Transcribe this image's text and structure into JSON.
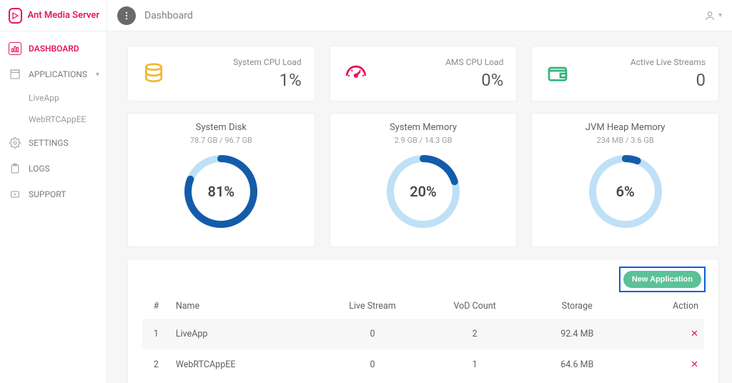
{
  "brand": "Ant Media Server",
  "page_title": "Dashboard",
  "sidebar": {
    "dashboard": "DASHBOARD",
    "applications": "APPLICATIONS",
    "app1": "LiveApp",
    "app2": "WebRTCAppEE",
    "settings": "SETTINGS",
    "logs": "LOGS",
    "support": "SUPPORT"
  },
  "stats": {
    "sys_cpu_label": "System CPU Load",
    "sys_cpu_value": "1%",
    "ams_cpu_label": "AMS CPU Load",
    "ams_cpu_value": "0%",
    "streams_label": "Active Live Streams",
    "streams_value": "0"
  },
  "gauges": {
    "disk_title": "System Disk",
    "disk_sub": "78.7 GB / 96.7 GB",
    "disk_pct": "81%",
    "mem_title": "System Memory",
    "mem_sub": "2.9 GB / 14.3 GB",
    "mem_pct": "20%",
    "jvm_title": "JVM Heap Memory",
    "jvm_sub": "234 MB / 3.6 GB",
    "jvm_pct": "6%"
  },
  "apps_table": {
    "new_app_button": "New Application",
    "col_idx": "#",
    "col_name": "Name",
    "col_live": "Live Stream",
    "col_vod": "VoD Count",
    "col_storage": "Storage",
    "col_action": "Action",
    "rows": [
      {
        "idx": "1",
        "name": "LiveApp",
        "live": "0",
        "vod": "2",
        "storage": "92.4 MB"
      },
      {
        "idx": "2",
        "name": "WebRTCAppEE",
        "live": "0",
        "vod": "1",
        "storage": "64.6 MB"
      }
    ]
  },
  "colors": {
    "accent": "#e6175d",
    "ring_bg": "#bfe0f6",
    "ring_fg": "#135caa",
    "green": "#38b27a",
    "gold": "#f0b82a"
  }
}
